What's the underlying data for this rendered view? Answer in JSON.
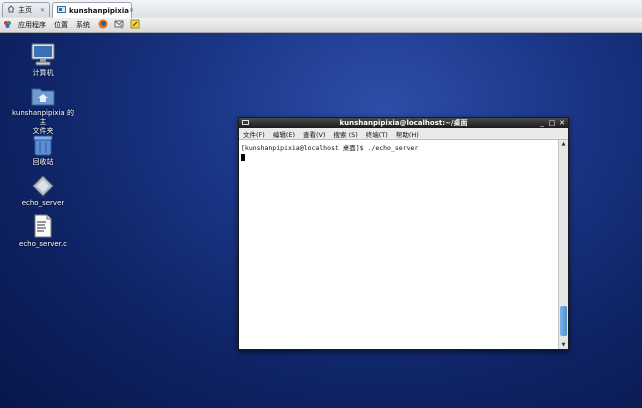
{
  "host_tabs": [
    {
      "label": "主页",
      "icon": "home-icon"
    },
    {
      "label": "kunshanpipixia",
      "icon": "vm-icon"
    }
  ],
  "panel": {
    "menus": [
      "应用程序",
      "位置",
      "系统"
    ],
    "launchers": [
      "firefox-icon",
      "mail-icon",
      "notes-icon"
    ]
  },
  "desktop_icons": [
    {
      "label": "计算机",
      "icon": "computer-icon"
    },
    {
      "label": "kunshanpipixia 的主\n文件夹",
      "icon": "home-folder-icon"
    },
    {
      "label": "回收站",
      "icon": "trash-icon"
    },
    {
      "label": "echo_server",
      "icon": "executable-icon"
    },
    {
      "label": "echo_server.c",
      "icon": "c-source-file-icon"
    }
  ],
  "terminal": {
    "title": "kunshanpipixia@localhost:~/桌面",
    "menu": [
      "文件(F)",
      "编辑(E)",
      "查看(V)",
      "搜索 (S)",
      "终端(T)",
      "帮助(H)"
    ],
    "lines": [
      "[kunshanpipixia@localhost 桌面]$ ./echo_server"
    ]
  }
}
